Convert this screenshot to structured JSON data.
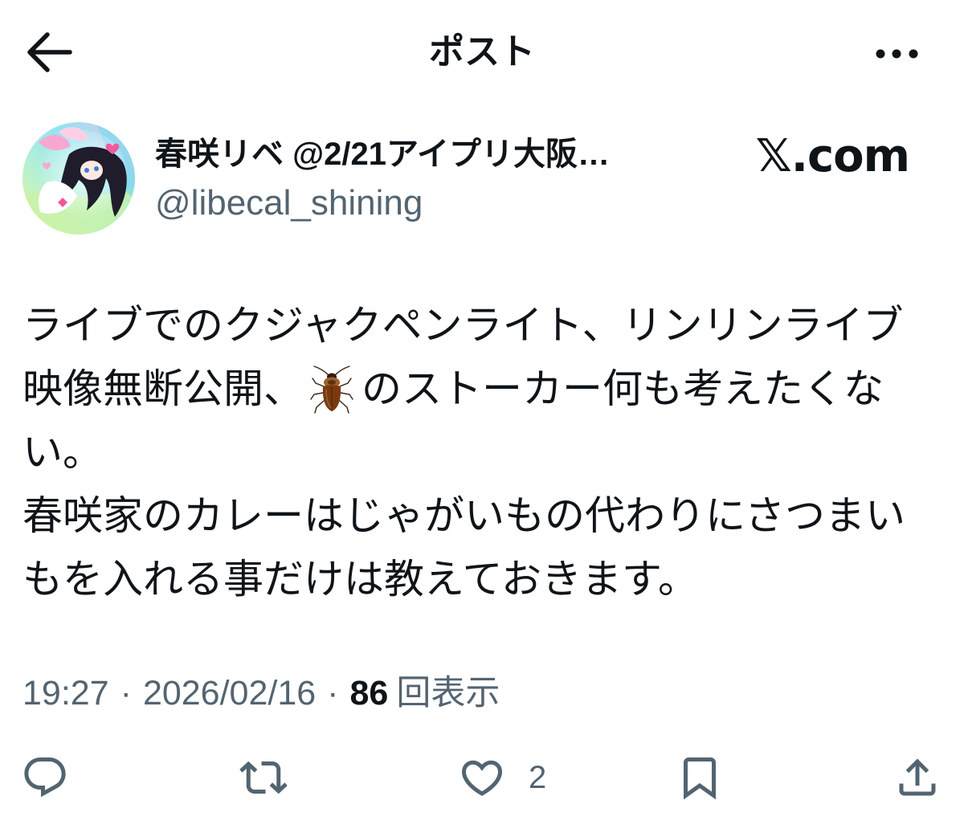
{
  "header": {
    "title": "ポスト",
    "back_icon": "arrow-left-icon",
    "more_icon": "more-horizontal-icon"
  },
  "author": {
    "display_name": "春咲リベ @2/21アイプリ大阪…",
    "handle": "@libecal_shining",
    "avatar_icon": "avatar-image"
  },
  "brand": {
    "text": "𝕏.com"
  },
  "post": {
    "line_1": "ライブでのクジャクペンライト、リンリンライブ",
    "line_2_before_emoji": "映像無断公開、",
    "emoji": "cockroach-emoji",
    "line_2_after_emoji": "のストーカー何も考えたくな",
    "line_3": "い。",
    "line_4": "春咲家のカレーはじゃがいもの代わりにさつまい",
    "line_5": "もを入れる事だけは教えておきます。"
  },
  "meta": {
    "time": "19:27",
    "separator": "·",
    "date": "2026/02/16",
    "views_count": "86",
    "views_label": "回表示"
  },
  "actions": {
    "reply_icon": "reply-icon",
    "repost_icon": "repost-icon",
    "like_icon": "heart-icon",
    "like_count": "2",
    "bookmark_icon": "bookmark-icon",
    "share_icon": "share-icon"
  },
  "colors": {
    "background": "#ffffff",
    "text_primary": "#0f1419",
    "text_secondary": "#536471"
  }
}
